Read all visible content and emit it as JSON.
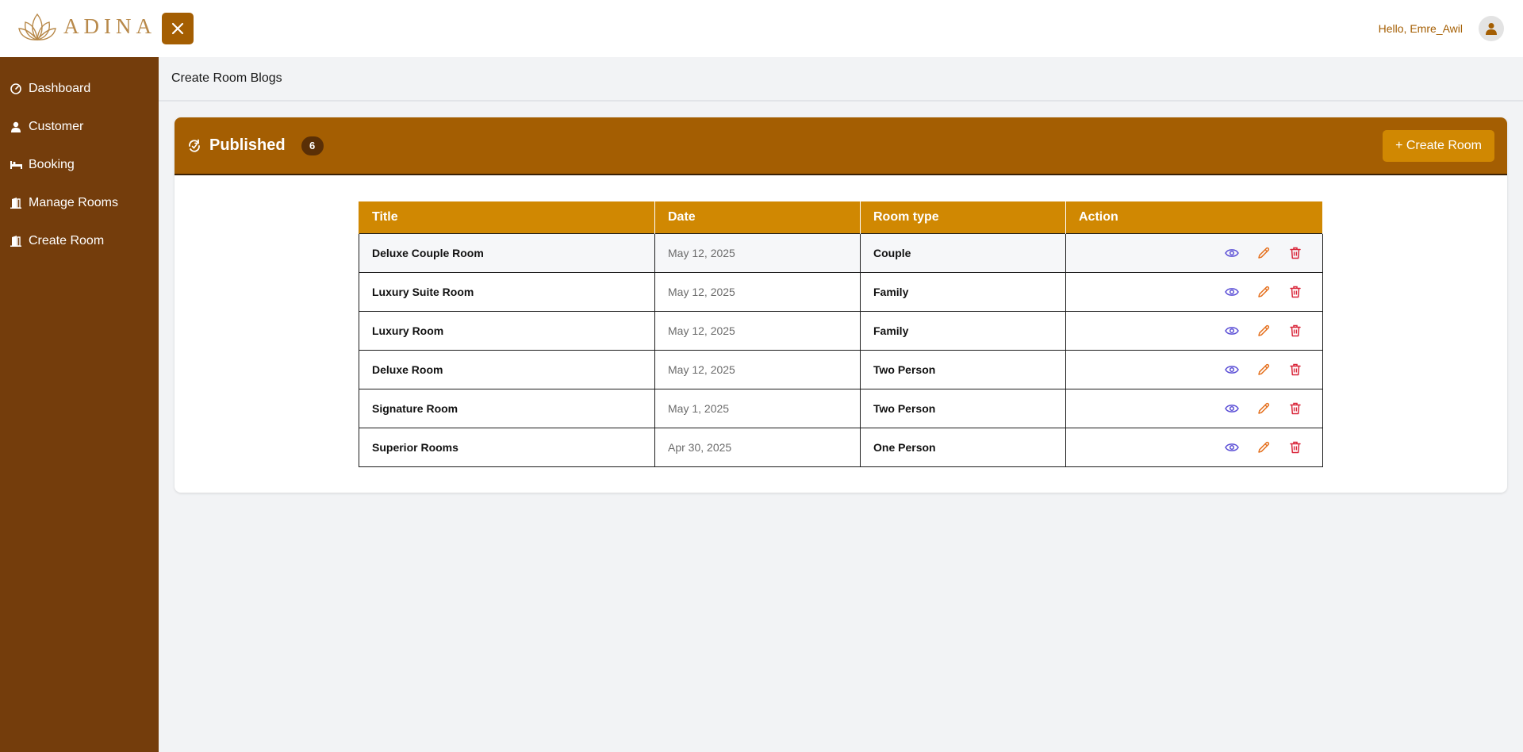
{
  "brand": {
    "name": "ADINA",
    "accent": "#a45e02",
    "sidebar_bg": "#743d0c",
    "table_header_bg": "#d08802"
  },
  "header": {
    "greeting": "Hello, Emre_Awil"
  },
  "sidebar": {
    "items": [
      {
        "label": "Dashboard",
        "icon": "gauge-icon"
      },
      {
        "label": "Customer",
        "icon": "user-icon"
      },
      {
        "label": "Booking",
        "icon": "bed-icon"
      },
      {
        "label": "Manage Rooms",
        "icon": "door-icon"
      },
      {
        "label": "Create Room",
        "icon": "door-icon"
      }
    ]
  },
  "page": {
    "title": "Create Room Blogs"
  },
  "card": {
    "title": "Published",
    "count": "6",
    "create_label": "+ Create Room"
  },
  "table": {
    "columns": [
      "Title",
      "Date",
      "Room type",
      "Action"
    ],
    "rows": [
      {
        "title": "Deluxe Couple Room",
        "date": "May 12, 2025",
        "type": "Couple"
      },
      {
        "title": "Luxury Suite Room",
        "date": "May 12, 2025",
        "type": "Family"
      },
      {
        "title": "Luxury Room",
        "date": "May 12, 2025",
        "type": "Family"
      },
      {
        "title": "Deluxe Room",
        "date": "May 12, 2025",
        "type": "Two Person"
      },
      {
        "title": "Signature Room",
        "date": "May 1, 2025",
        "type": "Two Person"
      },
      {
        "title": "Superior Rooms",
        "date": "Apr 30, 2025",
        "type": "One Person"
      }
    ],
    "action_icons": [
      "eye-icon",
      "pencil-icon",
      "trash-icon"
    ],
    "action_colors": {
      "view": "#5b4fd6",
      "edit": "#e5711f",
      "delete": "#d9263a"
    }
  }
}
